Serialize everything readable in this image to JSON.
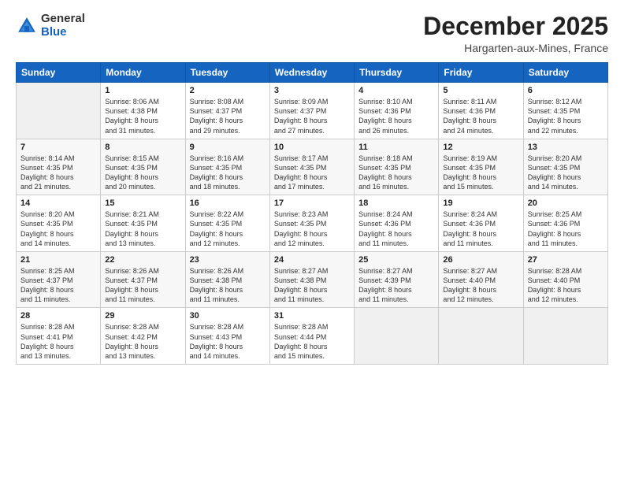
{
  "header": {
    "logo_general": "General",
    "logo_blue": "Blue",
    "month": "December 2025",
    "location": "Hargarten-aux-Mines, France"
  },
  "weekdays": [
    "Sunday",
    "Monday",
    "Tuesday",
    "Wednesday",
    "Thursday",
    "Friday",
    "Saturday"
  ],
  "weeks": [
    [
      {
        "day": "",
        "info": ""
      },
      {
        "day": "1",
        "info": "Sunrise: 8:06 AM\nSunset: 4:38 PM\nDaylight: 8 hours\nand 31 minutes."
      },
      {
        "day": "2",
        "info": "Sunrise: 8:08 AM\nSunset: 4:37 PM\nDaylight: 8 hours\nand 29 minutes."
      },
      {
        "day": "3",
        "info": "Sunrise: 8:09 AM\nSunset: 4:37 PM\nDaylight: 8 hours\nand 27 minutes."
      },
      {
        "day": "4",
        "info": "Sunrise: 8:10 AM\nSunset: 4:36 PM\nDaylight: 8 hours\nand 26 minutes."
      },
      {
        "day": "5",
        "info": "Sunrise: 8:11 AM\nSunset: 4:36 PM\nDaylight: 8 hours\nand 24 minutes."
      },
      {
        "day": "6",
        "info": "Sunrise: 8:12 AM\nSunset: 4:35 PM\nDaylight: 8 hours\nand 22 minutes."
      }
    ],
    [
      {
        "day": "7",
        "info": "Sunrise: 8:14 AM\nSunset: 4:35 PM\nDaylight: 8 hours\nand 21 minutes."
      },
      {
        "day": "8",
        "info": "Sunrise: 8:15 AM\nSunset: 4:35 PM\nDaylight: 8 hours\nand 20 minutes."
      },
      {
        "day": "9",
        "info": "Sunrise: 8:16 AM\nSunset: 4:35 PM\nDaylight: 8 hours\nand 18 minutes."
      },
      {
        "day": "10",
        "info": "Sunrise: 8:17 AM\nSunset: 4:35 PM\nDaylight: 8 hours\nand 17 minutes."
      },
      {
        "day": "11",
        "info": "Sunrise: 8:18 AM\nSunset: 4:35 PM\nDaylight: 8 hours\nand 16 minutes."
      },
      {
        "day": "12",
        "info": "Sunrise: 8:19 AM\nSunset: 4:35 PM\nDaylight: 8 hours\nand 15 minutes."
      },
      {
        "day": "13",
        "info": "Sunrise: 8:20 AM\nSunset: 4:35 PM\nDaylight: 8 hours\nand 14 minutes."
      }
    ],
    [
      {
        "day": "14",
        "info": "Sunrise: 8:20 AM\nSunset: 4:35 PM\nDaylight: 8 hours\nand 14 minutes."
      },
      {
        "day": "15",
        "info": "Sunrise: 8:21 AM\nSunset: 4:35 PM\nDaylight: 8 hours\nand 13 minutes."
      },
      {
        "day": "16",
        "info": "Sunrise: 8:22 AM\nSunset: 4:35 PM\nDaylight: 8 hours\nand 12 minutes."
      },
      {
        "day": "17",
        "info": "Sunrise: 8:23 AM\nSunset: 4:35 PM\nDaylight: 8 hours\nand 12 minutes."
      },
      {
        "day": "18",
        "info": "Sunrise: 8:24 AM\nSunset: 4:36 PM\nDaylight: 8 hours\nand 11 minutes."
      },
      {
        "day": "19",
        "info": "Sunrise: 8:24 AM\nSunset: 4:36 PM\nDaylight: 8 hours\nand 11 minutes."
      },
      {
        "day": "20",
        "info": "Sunrise: 8:25 AM\nSunset: 4:36 PM\nDaylight: 8 hours\nand 11 minutes."
      }
    ],
    [
      {
        "day": "21",
        "info": "Sunrise: 8:25 AM\nSunset: 4:37 PM\nDaylight: 8 hours\nand 11 minutes."
      },
      {
        "day": "22",
        "info": "Sunrise: 8:26 AM\nSunset: 4:37 PM\nDaylight: 8 hours\nand 11 minutes."
      },
      {
        "day": "23",
        "info": "Sunrise: 8:26 AM\nSunset: 4:38 PM\nDaylight: 8 hours\nand 11 minutes."
      },
      {
        "day": "24",
        "info": "Sunrise: 8:27 AM\nSunset: 4:38 PM\nDaylight: 8 hours\nand 11 minutes."
      },
      {
        "day": "25",
        "info": "Sunrise: 8:27 AM\nSunset: 4:39 PM\nDaylight: 8 hours\nand 11 minutes."
      },
      {
        "day": "26",
        "info": "Sunrise: 8:27 AM\nSunset: 4:40 PM\nDaylight: 8 hours\nand 12 minutes."
      },
      {
        "day": "27",
        "info": "Sunrise: 8:28 AM\nSunset: 4:40 PM\nDaylight: 8 hours\nand 12 minutes."
      }
    ],
    [
      {
        "day": "28",
        "info": "Sunrise: 8:28 AM\nSunset: 4:41 PM\nDaylight: 8 hours\nand 13 minutes."
      },
      {
        "day": "29",
        "info": "Sunrise: 8:28 AM\nSunset: 4:42 PM\nDaylight: 8 hours\nand 13 minutes."
      },
      {
        "day": "30",
        "info": "Sunrise: 8:28 AM\nSunset: 4:43 PM\nDaylight: 8 hours\nand 14 minutes."
      },
      {
        "day": "31",
        "info": "Sunrise: 8:28 AM\nSunset: 4:44 PM\nDaylight: 8 hours\nand 15 minutes."
      },
      {
        "day": "",
        "info": ""
      },
      {
        "day": "",
        "info": ""
      },
      {
        "day": "",
        "info": ""
      }
    ]
  ]
}
